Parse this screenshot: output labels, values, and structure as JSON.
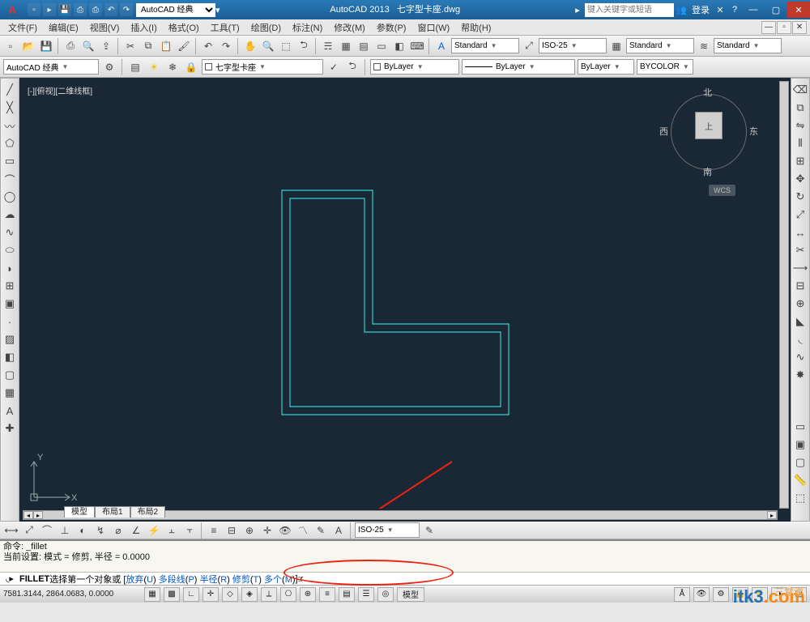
{
  "title": {
    "app": "AutoCAD 2013",
    "file": "七字型卡座.dwg",
    "ws_dropdown": "AutoCAD 经典"
  },
  "search_placeholder": "键入关键字或短语",
  "login": "登录",
  "menu": [
    "文件(F)",
    "编辑(E)",
    "视图(V)",
    "插入(I)",
    "格式(O)",
    "工具(T)",
    "绘图(D)",
    "标注(N)",
    "修改(M)",
    "参数(P)",
    "窗口(W)",
    "帮助(H)"
  ],
  "style_combos": {
    "text": "Standard",
    "dim": "ISO-25",
    "table": "Standard",
    "ml": "Standard"
  },
  "ws_row": {
    "workspace": "AutoCAD 经典",
    "layer": "七字型卡座"
  },
  "props": {
    "bylayer1": "ByLayer",
    "bylayer2": "ByLayer",
    "bylayer3": "ByLayer",
    "bycolor": "BYCOLOR"
  },
  "viewport_label": "[-][俯视][二维线框]",
  "viewcube": {
    "n": "北",
    "s": "南",
    "e": "东",
    "w": "西",
    "top": "上",
    "wcs": "WCS"
  },
  "ucs": {
    "x": "X",
    "y": "Y"
  },
  "layout_tabs": [
    "模型",
    "布局1",
    "布局2"
  ],
  "dim_edit": "ISO-25",
  "cmd": {
    "line1": "命令: _fillet",
    "line2": "当前设置: 模式 = 修剪, 半径 = 0.0000",
    "prompt_cmd": "FILLET",
    "prompt_pre": " 选择第一个对象或 [",
    "opts": [
      {
        "label": "放弃",
        "key": "U"
      },
      {
        "label": "多段线",
        "key": "P"
      },
      {
        "label": "半径",
        "key": "R"
      },
      {
        "label": "修剪",
        "key": "T"
      },
      {
        "label": "多个",
        "key": "M"
      }
    ],
    "prompt_post": "]: ",
    "typed": "r"
  },
  "status": {
    "coords": "7581.3144, 2864.0683, 0.0000",
    "space_btn": "模型"
  },
  "watermark": {
    "txt": "itk3",
    "dot": ".com",
    "tag": "三堂课"
  },
  "colors": {
    "canvas": "#1a2835",
    "shape": "#2fd1d1",
    "accent_red": "#e21b1b"
  }
}
